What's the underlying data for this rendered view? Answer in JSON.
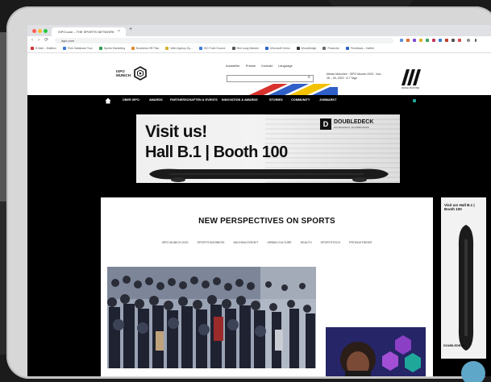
{
  "browser": {
    "tab_title": "ISPO.com – THE SPORTS NETWORK",
    "tab_close": "×",
    "new_tab": "+",
    "url": "ispo.com",
    "back": "‹",
    "forward": "›",
    "reload": "⟳",
    "bookmarks": [
      "E-Mail – Mailbox",
      "Free Database Tour",
      "Sports Marketing",
      "Business HR Plan",
      "Web Agency Sy...",
      "ISO Tube Source",
      "Bird Lang Marken",
      "Microsoft Demo",
      "Woodbridge",
      "Financier",
      "Feedback – Kaffee"
    ]
  },
  "site": {
    "logo_text": "ISPO MUNICH",
    "top_links": [
      "Aussteller",
      "Presse",
      "Kontakt",
      "Language"
    ],
    "search_glyph": "⌕",
    "event_info": "Messe München · ISPO Munich 2023 · Nov. 28 – 30, 2023 · 6-7 Tage",
    "brand_sub": "MESSE MÜNCHEN",
    "nav": [
      "ÜBER ISPO",
      "AWARDS",
      "PARTNERSCHAFTEN & EVENTS",
      "INNOVATION & AWARDS",
      "STORIES",
      "COMMUNITY",
      "JOBMARKT"
    ]
  },
  "banner": {
    "line1": "Visit us!",
    "line2": "Hall B.1 | Booth 100",
    "brand_letter": "D",
    "brand_name": "DOUBLEDECK",
    "brand_tag": "DOUBLEDECK SKATEBOARDS"
  },
  "content": {
    "section_title": "NEW PERSPECTIVES ON SPORTS",
    "categories": [
      "ISPO MUNICH 2023",
      "SPORTS BUSINESS",
      "NACHHALTIGKEIT",
      "URBAN CULTURE",
      "HEALTH",
      "SPORTSTECH",
      "PRODUKTNEWS"
    ]
  },
  "side_ad": {
    "text": "Visit us! Hall B.1 | Booth 100",
    "brand": "DOUBLEDECK"
  },
  "colors": {
    "accent_teal": "#1fa79a",
    "stripe_red": "#d8322e",
    "stripe_blue": "#2f5fc7",
    "stripe_yellow": "#f2c200"
  }
}
